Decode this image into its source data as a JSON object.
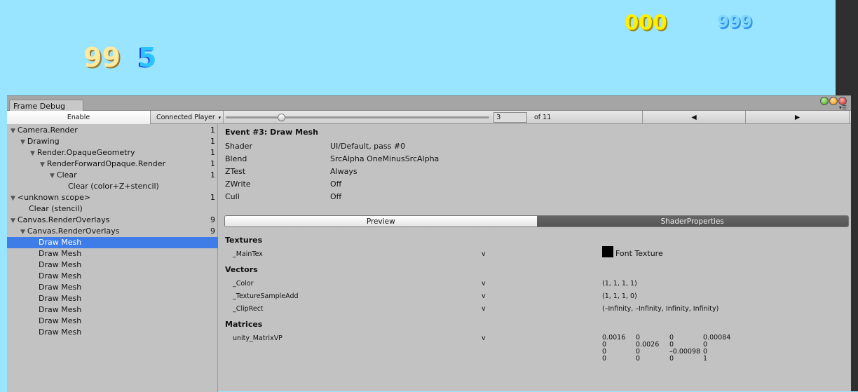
{
  "game_view": {
    "score_left": "99",
    "lives": "5",
    "score_top": "000",
    "score_top_right": "999"
  },
  "window": {
    "tab_title": "Frame Debug"
  },
  "toolbar": {
    "enable_label": "Enable",
    "player_dropdown": "Connected Player",
    "event_index": "3",
    "event_total": "of 11",
    "slider_fraction": 0.21
  },
  "tree": [
    {
      "label": "Camera.Render",
      "count": "1",
      "level": 0,
      "expanded": true
    },
    {
      "label": "Drawing",
      "count": "1",
      "level": 1,
      "expanded": true
    },
    {
      "label": "Render.OpaqueGeometry",
      "count": "1",
      "level": 2,
      "expanded": true
    },
    {
      "label": "RenderForwardOpaque.Render",
      "count": "1",
      "level": 3,
      "expanded": true
    },
    {
      "label": "Clear",
      "count": "1",
      "level": 4,
      "expanded": true
    },
    {
      "label": "Clear (color+Z+stencil)",
      "count": "",
      "level": 5,
      "leaf": true
    },
    {
      "label": "<unknown scope>",
      "count": "1",
      "level": 0,
      "expanded": true
    },
    {
      "label": "Clear (stencil)",
      "count": "",
      "level": 1,
      "leaf": true
    },
    {
      "label": "Canvas.RenderOverlays",
      "count": "9",
      "level": 0,
      "expanded": true
    },
    {
      "label": "Canvas.RenderOverlays",
      "count": "9",
      "level": 1,
      "expanded": true
    },
    {
      "label": "Draw Mesh",
      "count": "",
      "level": 2,
      "leaf": true,
      "selected": true
    },
    {
      "label": "Draw Mesh",
      "count": "",
      "level": 2,
      "leaf": true
    },
    {
      "label": "Draw Mesh",
      "count": "",
      "level": 2,
      "leaf": true
    },
    {
      "label": "Draw Mesh",
      "count": "",
      "level": 2,
      "leaf": true
    },
    {
      "label": "Draw Mesh",
      "count": "",
      "level": 2,
      "leaf": true
    },
    {
      "label": "Draw Mesh",
      "count": "",
      "level": 2,
      "leaf": true
    },
    {
      "label": "Draw Mesh",
      "count": "",
      "level": 2,
      "leaf": true
    },
    {
      "label": "Draw Mesh",
      "count": "",
      "level": 2,
      "leaf": true
    },
    {
      "label": "Draw Mesh",
      "count": "",
      "level": 2,
      "leaf": true
    }
  ],
  "event": {
    "title": "Event #3: Draw Mesh",
    "props": [
      {
        "name": "Shader",
        "value": "UI/Default, pass #0"
      },
      {
        "name": "Blend",
        "value": "SrcAlpha OneMinusSrcAlpha"
      },
      {
        "name": "ZTest",
        "value": "Always"
      },
      {
        "name": "ZWrite",
        "value": "Off"
      },
      {
        "name": "Cull",
        "value": "Off"
      }
    ],
    "tabs": {
      "preview": "Preview",
      "shader_properties": "ShaderProperties"
    },
    "sections": {
      "textures": {
        "title": "Textures",
        "items": [
          {
            "name": "_MainTex",
            "stage": "v",
            "value": "Font Texture"
          }
        ]
      },
      "vectors": {
        "title": "Vectors",
        "items": [
          {
            "name": "_Color",
            "stage": "v",
            "value": "(1, 1, 1, 1)"
          },
          {
            "name": "_TextureSampleAdd",
            "stage": "v",
            "value": "(1, 1, 1, 0)"
          },
          {
            "name": "_ClipRect",
            "stage": "v",
            "value": "(–Infinity, –Infinity, Infinity, Infinity)"
          }
        ]
      },
      "matrices": {
        "title": "Matrices",
        "items": [
          {
            "name": "unity_MatrixVP",
            "stage": "v",
            "rows": [
              [
                "0.0016",
                "0",
                "0",
                "0.00084"
              ],
              [
                "0",
                "0.0026",
                "0",
                "0"
              ],
              [
                "0",
                "0",
                "–0.00098",
                "0"
              ],
              [
                "0",
                "0",
                "0",
                "1"
              ]
            ]
          }
        ]
      }
    }
  }
}
